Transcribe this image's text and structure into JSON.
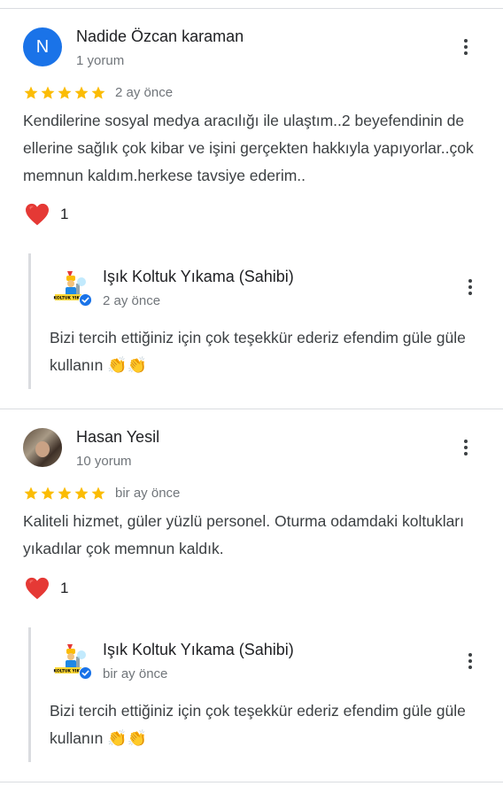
{
  "reviews": [
    {
      "author": "Nadide Özcan karaman",
      "avatar_letter": "N",
      "review_count": "1 yorum",
      "rating": 5,
      "time": "2 ay önce",
      "text": "Kendilerine sosyal medya aracılığı ile ulaştım..2 beyefendinin de ellerine sağlık çok kibar ve işini gerçekten hakkıyla yapıyorlar..çok memnun kaldım.herkese tavsiye ederim..",
      "likes": "1",
      "owner_reply": {
        "owner": "Işık Koltuk Yıkama (Sahibi)",
        "time": "2 ay önce",
        "text": "Bizi tercih ettiğiniz için çok teşekkür ederiz efendim güle güle kullanın",
        "emoji": "👏👏"
      }
    },
    {
      "author": "Hasan Yesil",
      "review_count": "10 yorum",
      "rating": 5,
      "time": "bir ay önce",
      "text": "Kaliteli hizmet, güler yüzlü personel. Oturma odamdaki koltukları yıkadılar çok memnun kaldık.",
      "likes": "1",
      "owner_reply": {
        "owner": "Işık Koltuk Yıkama (Sahibi)",
        "time": "bir ay önce",
        "text": "Bizi tercih ettiğiniz için çok teşekkür ederiz efendim güle güle kullanın",
        "emoji": "👏👏"
      }
    }
  ],
  "colors": {
    "star": "#fbbc04",
    "heart": "#e53935",
    "avatar_bg": "#1a73e8",
    "verified": "#1a73e8",
    "divider": "#dadce0"
  },
  "icons": {
    "more": "more-vert-icon",
    "star": "star-icon",
    "like": "heart-icon",
    "verified": "verified-badge-icon"
  },
  "owner_logo_text": "KOLTUK YIKA"
}
